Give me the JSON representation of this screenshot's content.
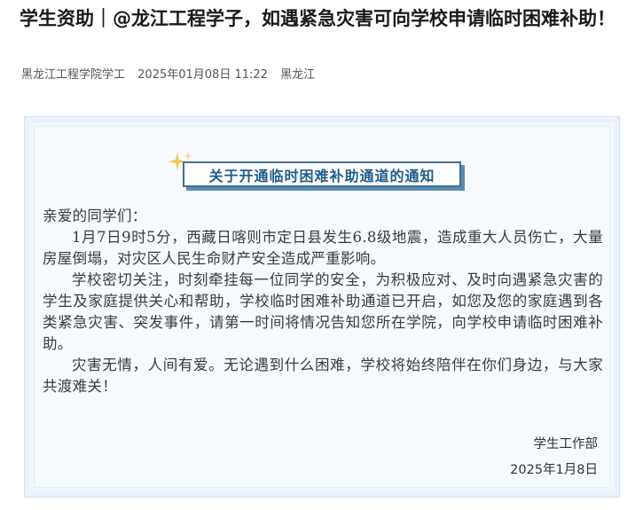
{
  "article": {
    "title": "学生资助｜@龙江工程学子，如遇紧急灾害可向学校申请临时困难补助！"
  },
  "meta": {
    "author": "黑龙江工程学院学工",
    "datetime": "2025年01月08日 11:22",
    "location": "黑龙江"
  },
  "notice": {
    "heading": "关于开通临时困难补助通道的通知",
    "greeting": "亲爱的同学们：",
    "paragraphs": [
      "1月7日9时5分，西藏日喀则市定日县发生6.8级地震，造成重大人员伤亡，大量房屋倒塌，对灾区人民生命财产安全造成严重影响。",
      "学校密切关注，时刻牵挂每一位同学的安全，为积极应对、及时向遇紧急灾害的学生及家庭提供关心和帮助，学校临时困难补助通道已开启，如您及您的家庭遇到各类紧急灾害、突发事件，请第一时间将情况告知您所在学院，向学校申请临时困难补助。",
      "灾害无情，人间有爱。无论遇到什么困难，学校将始终陪伴在你们身边，与大家共渡难关！"
    ],
    "signature": {
      "department": "学生工作部",
      "date": "2025年1月8日"
    }
  },
  "colors": {
    "heading_text": "#1f5d8c",
    "heading_border": "#3f6f95",
    "card_background": "#f1f7fc",
    "sparkle": "#f2c94c"
  },
  "icons": {
    "sparkle": "sparkle-icon"
  }
}
